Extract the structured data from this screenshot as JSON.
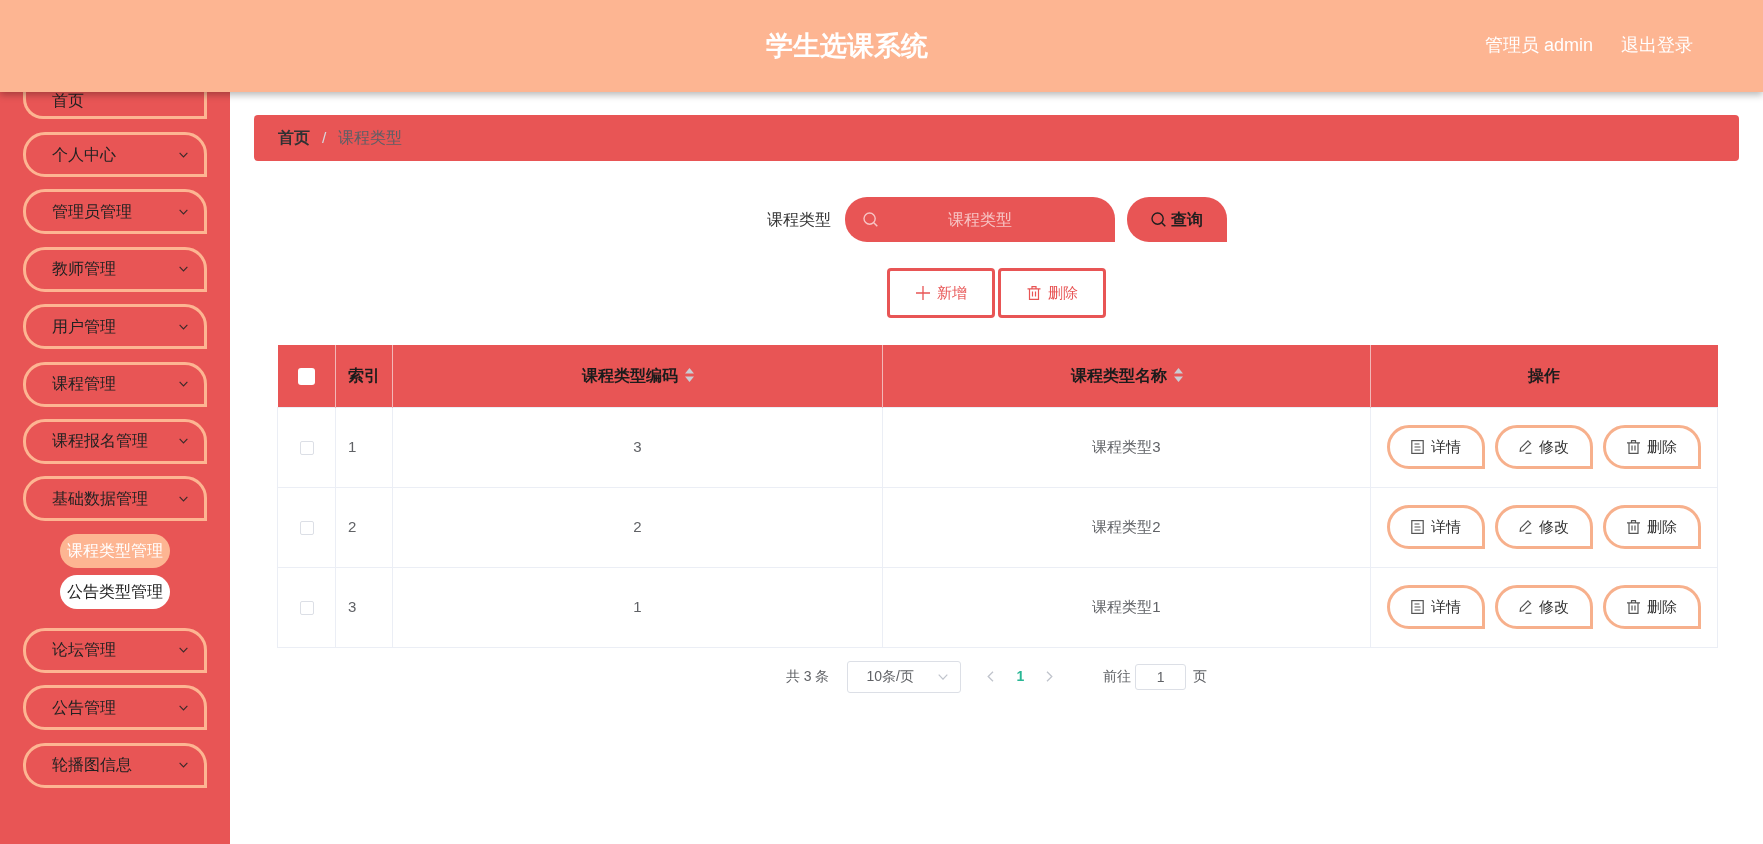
{
  "header": {
    "title": "学生选课系统",
    "user": "管理员 admin",
    "logout": "退出登录"
  },
  "sidebar": {
    "items": [
      {
        "label": "首页",
        "caret": false
      },
      {
        "label": "个人中心",
        "caret": true
      },
      {
        "label": "管理员管理",
        "caret": true
      },
      {
        "label": "教师管理",
        "caret": true
      },
      {
        "label": "用户管理",
        "caret": true
      },
      {
        "label": "课程管理",
        "caret": true
      },
      {
        "label": "课程报名管理",
        "caret": true
      },
      {
        "label": "基础数据管理",
        "caret": true,
        "children": [
          {
            "label": "课程类型管理",
            "selected": true
          },
          {
            "label": "公告类型管理",
            "selected": false
          }
        ]
      },
      {
        "label": "论坛管理",
        "caret": true
      },
      {
        "label": "公告管理",
        "caret": true
      },
      {
        "label": "轮播图信息",
        "caret": true
      }
    ]
  },
  "breadcrumb": {
    "separator": "/",
    "items": [
      {
        "label": "首页",
        "current": false
      },
      {
        "label": "课程类型",
        "current": true
      }
    ]
  },
  "search": {
    "label": "课程类型",
    "placeholder": "课程类型",
    "button": "查询"
  },
  "toolbar": [
    {
      "kind": "add",
      "label": "新增"
    },
    {
      "kind": "delete",
      "label": "删除"
    }
  ],
  "table": {
    "select_all": {
      "checked": false
    },
    "columns": [
      {
        "label": "索引",
        "sortable": false
      },
      {
        "label": "课程类型编码",
        "sortable": true
      },
      {
        "label": "课程类型名称",
        "sortable": true
      },
      {
        "label": "操作",
        "sortable": false
      }
    ],
    "rows": [
      {
        "selected": false,
        "cells": [
          "1",
          "3",
          "课程类型3"
        ],
        "actions": [
          {
            "kind": "detail",
            "label": "详情"
          },
          {
            "kind": "edit",
            "label": "修改"
          },
          {
            "kind": "delete",
            "label": "删除"
          }
        ]
      },
      {
        "selected": false,
        "cells": [
          "2",
          "2",
          "课程类型2"
        ],
        "actions": [
          {
            "kind": "detail",
            "label": "详情"
          },
          {
            "kind": "edit",
            "label": "修改"
          },
          {
            "kind": "delete",
            "label": "删除"
          }
        ]
      },
      {
        "selected": false,
        "cells": [
          "3",
          "1",
          "课程类型1"
        ],
        "actions": [
          {
            "kind": "detail",
            "label": "详情"
          },
          {
            "kind": "edit",
            "label": "修改"
          },
          {
            "kind": "delete",
            "label": "删除"
          }
        ]
      }
    ]
  },
  "pagination": {
    "total": "共 3 条",
    "page_size": "10条/页",
    "pages": [
      {
        "label": "1",
        "selected": true
      }
    ],
    "goto_label": "前往",
    "goto_value": "1",
    "goto_suffix": "页"
  }
}
